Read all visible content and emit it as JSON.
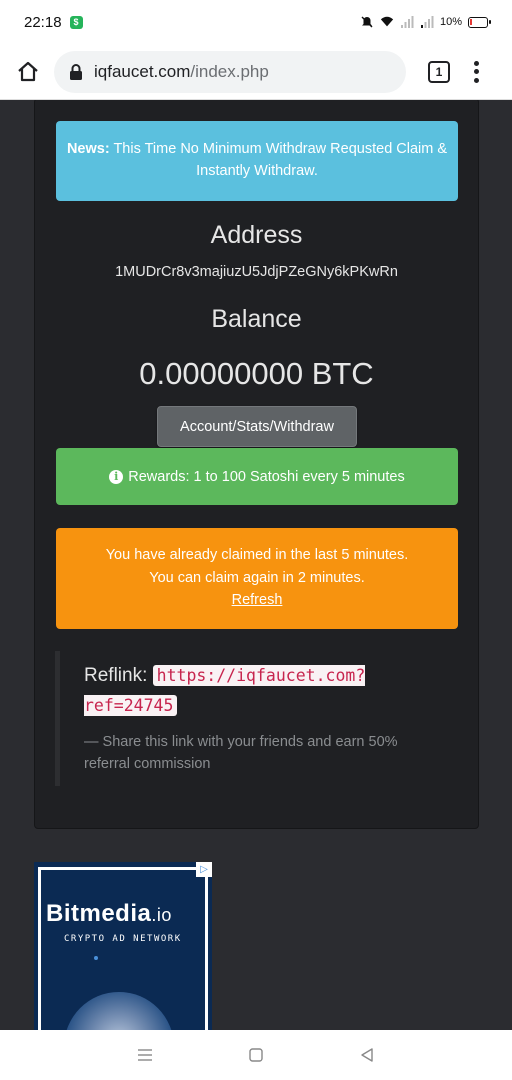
{
  "status_bar": {
    "time": "22:18",
    "battery": "10%"
  },
  "browser": {
    "url_host": "iqfaucet.com",
    "url_path": "/index.php",
    "tab_count": "1"
  },
  "news": {
    "label": "News:",
    "text": "This Time No Minimum Withdraw Requsted Claim & Instantly Withdraw."
  },
  "address": {
    "title": "Address",
    "value": "1MUDrCr8v3majiuzU5JdjPZeGNy6kPKwRn"
  },
  "balance": {
    "title": "Balance",
    "value": "0.00000000 BTC"
  },
  "account_button": "Account/Stats/Withdraw",
  "rewards": {
    "text": "Rewards: 1 to 100 Satoshi every 5 minutes"
  },
  "claim_warning": {
    "line1": "You have already claimed in the last 5 minutes.",
    "line2": "You can claim again in 2 minutes.",
    "refresh": "Refresh"
  },
  "reflink": {
    "label": "Reflink:",
    "url": "https://iqfaucet.com?ref=24745",
    "note": "— Share this link with your friends and earn 50% referral commission"
  },
  "ad": {
    "brand": "Bitmedia",
    "brand_suffix": ".io",
    "tagline": "CRYPTO AD NETWORK"
  },
  "colors": {
    "news_bg": "#5bc0de",
    "rewards_bg": "#5cb85c",
    "warning_bg": "#f7930f",
    "card_bg": "#1f2023",
    "page_bg": "#2b2c30"
  },
  "icons": [
    "home-icon",
    "lock-icon",
    "tabs-icon",
    "more-vert-icon",
    "info-icon",
    "recents-icon",
    "home-nav-icon",
    "back-icon",
    "adchoices-icon"
  ]
}
